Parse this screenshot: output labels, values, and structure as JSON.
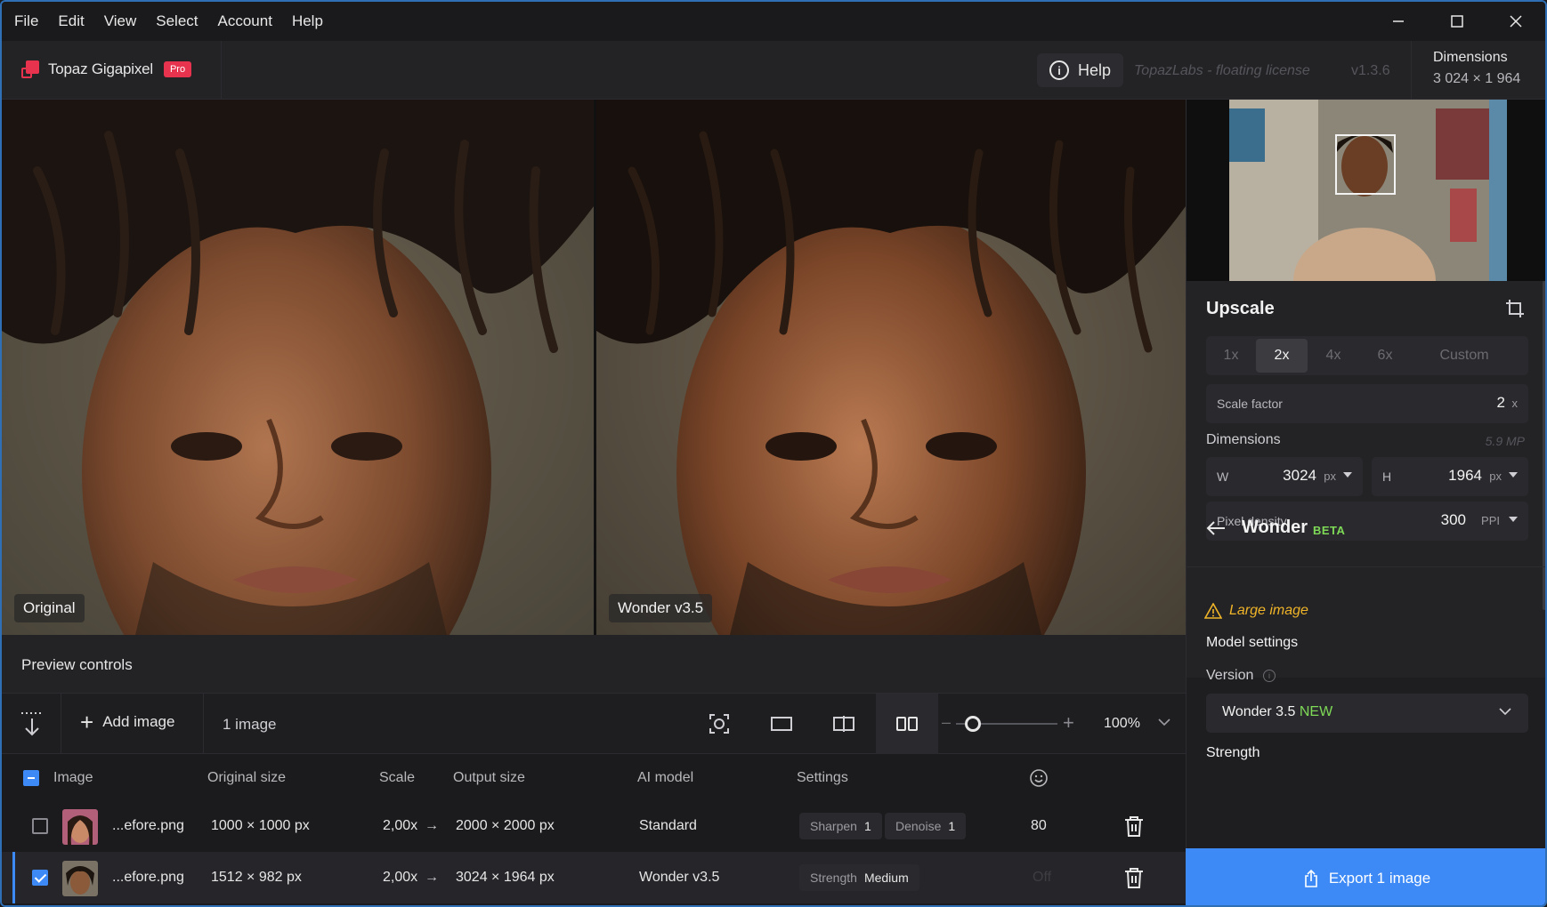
{
  "menu": [
    "File",
    "Edit",
    "View",
    "Select",
    "Account",
    "Help"
  ],
  "header": {
    "app_name": "Topaz Gigapixel",
    "pro_badge": "Pro",
    "help_label": "Help",
    "license": "TopazLabs - floating license",
    "version": "v1.3.6",
    "dims_label": "Dimensions",
    "dims_value": "3 024 × 1 964"
  },
  "preview": {
    "left_label": "Original",
    "right_label": "Wonder v3.5"
  },
  "preview_controls": {
    "title": "Preview controls",
    "add_image": "Add image",
    "image_count": "1 image",
    "zoom": "100%"
  },
  "table": {
    "headers": [
      "Image",
      "Original size",
      "Scale",
      "Output size",
      "AI model",
      "Settings"
    ],
    "rows": [
      {
        "name": "...efore.png",
        "original": "1000 × 1000 px",
        "scale": "2,00x",
        "output": "2000 × 2000 px",
        "model": "Standard",
        "setting1_label": "Sharpen",
        "setting1_value": "1",
        "setting2_label": "Denoise",
        "setting2_value": "1",
        "face": "80"
      },
      {
        "name": "...efore.png",
        "original": "1512 × 982 px",
        "scale": "2,00x",
        "output": "3024 × 1964 px",
        "model": "Wonder v3.5",
        "setting1_label": "Strength",
        "setting1_value": "Medium",
        "face": "Off"
      }
    ]
  },
  "upscale": {
    "title": "Upscale",
    "scale_options": [
      "1x",
      "2x",
      "4x",
      "6x",
      "Custom"
    ],
    "selected_scale": "2x",
    "scale_factor_label": "Scale factor",
    "scale_factor_value": "2",
    "scale_factor_unit": "x",
    "dimensions_label": "Dimensions",
    "megapixels": "5.9 MP",
    "width_label": "W",
    "width_value": "3024",
    "height_label": "H",
    "height_value": "1964",
    "px_unit": "px",
    "density_label": "Pixel density",
    "density_value": "300",
    "density_unit": "PPI"
  },
  "model": {
    "name": "Wonder",
    "badge": "BETA",
    "warning": "Large image",
    "settings_title": "Model settings",
    "version_label": "Version",
    "version_value": "Wonder 3.5",
    "version_new": "NEW",
    "strength_label": "Strength"
  },
  "export": {
    "label": "Export 1 image"
  },
  "colors": {
    "accent": "#3d8af7",
    "brand": "#e8334f",
    "new_green": "#7ed957",
    "warning": "#f0b428"
  }
}
